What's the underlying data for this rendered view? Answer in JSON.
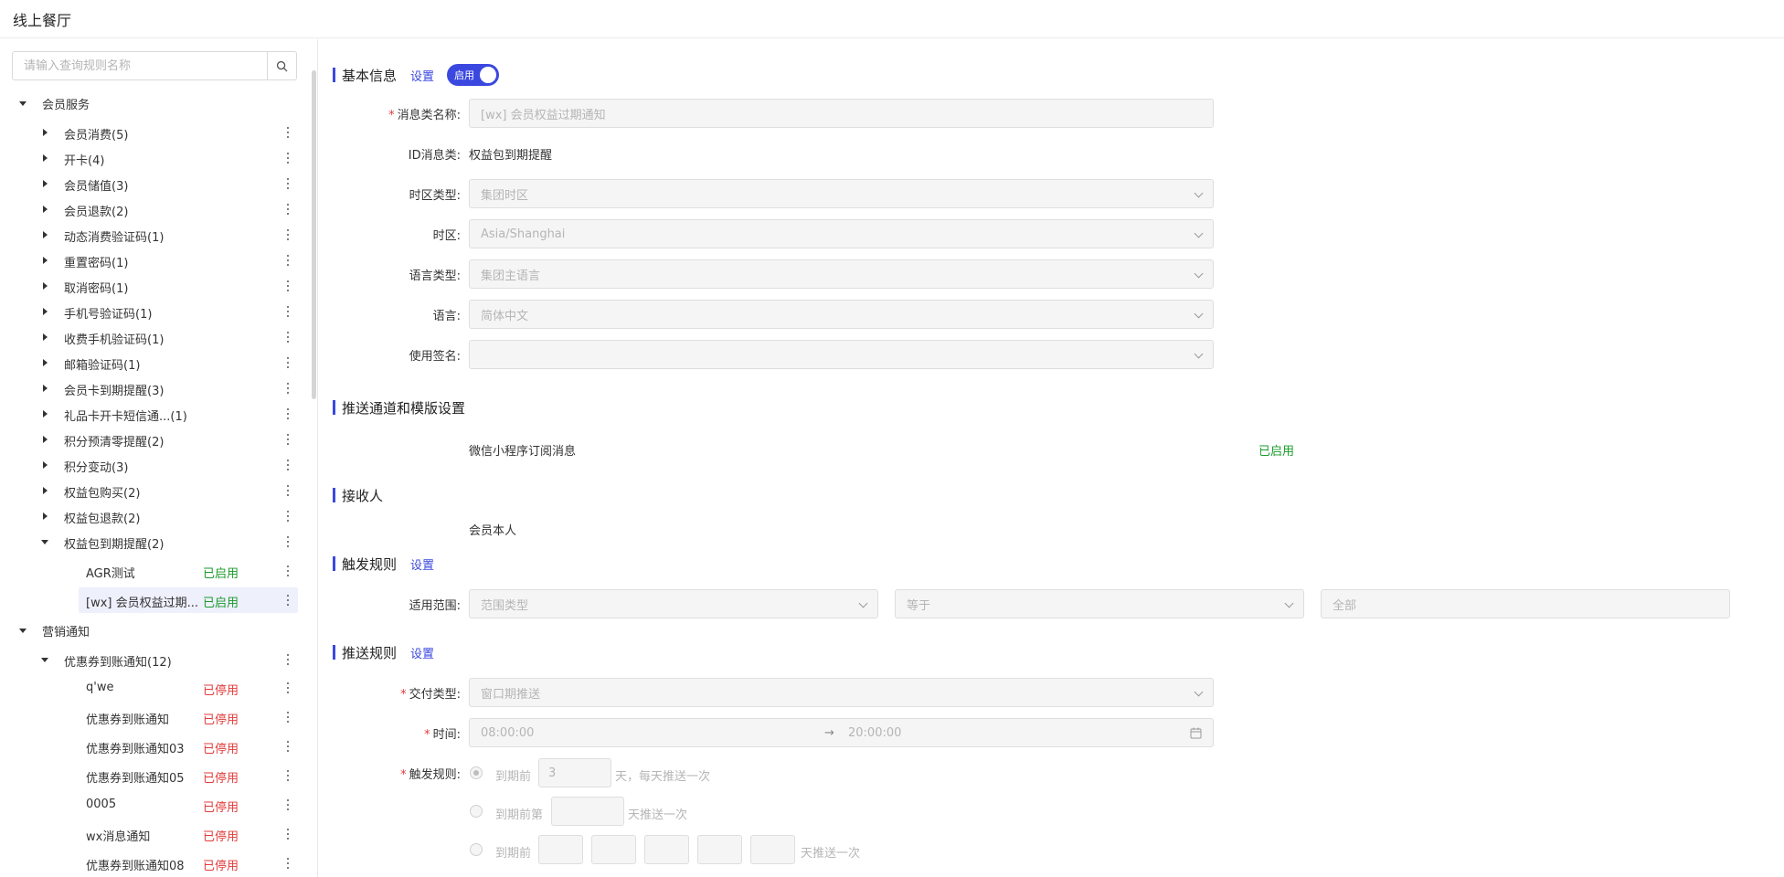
{
  "app": {
    "title": "线上餐厅"
  },
  "search": {
    "placeholder": "请输入查询规则名称"
  },
  "tree": {
    "groups": [
      {
        "label": "会员服务"
      },
      {
        "label": "营销通知"
      }
    ],
    "items": [
      {
        "label": "会员消费(5)"
      },
      {
        "label": "开卡(4)"
      },
      {
        "label": "会员储值(3)"
      },
      {
        "label": "会员退款(2)"
      },
      {
        "label": "动态消费验证码(1)"
      },
      {
        "label": "重置密码(1)"
      },
      {
        "label": "取消密码(1)"
      },
      {
        "label": "手机号验证码(1)"
      },
      {
        "label": "收费手机验证码(1)"
      },
      {
        "label": "邮箱验证码(1)"
      },
      {
        "label": "会员卡到期提醒(3)"
      },
      {
        "label": "礼品卡开卡短信通...(1)"
      },
      {
        "label": "积分预清零提醒(2)"
      },
      {
        "label": "积分变动(3)"
      },
      {
        "label": "权益包购买(2)"
      },
      {
        "label": "权益包退款(2)"
      },
      {
        "label": "权益包到期提醒(2)"
      },
      {
        "label": "优惠券到账通知(12)"
      }
    ],
    "leaves": [
      {
        "label": "AGR测试",
        "status": "已启用"
      },
      {
        "label": "[wx] 会员权益过期...",
        "status": "已启用"
      },
      {
        "label": "q'we",
        "status": "已停用"
      },
      {
        "label": "优惠券到账通知",
        "status": "已停用"
      },
      {
        "label": "优惠券到账通知03",
        "status": "已停用"
      },
      {
        "label": "优惠券到账通知05",
        "status": "已停用"
      },
      {
        "label": "0005",
        "status": "已停用"
      },
      {
        "label": "wx消息通知",
        "status": "已停用"
      },
      {
        "label": "优惠券到账通知08",
        "status": "已停用"
      }
    ]
  },
  "basic": {
    "title": "基本信息",
    "settings_link": "设置",
    "toggle_label": "启用",
    "fields": {
      "msg_name_label": "消息类名称:",
      "msg_name_value": "[wx] 会员权益过期通知",
      "id_label": "ID消息类:",
      "id_value": "权益包到期提醒",
      "tz_type_label": "时区类型:",
      "tz_type_value": "集团时区",
      "tz_label": "时区:",
      "tz_value": "Asia/Shanghai",
      "lang_type_label": "语言类型:",
      "lang_type_value": "集团主语言",
      "lang_label": "语言:",
      "lang_value": "简体中文",
      "sign_label": "使用签名:",
      "sign_value": ""
    }
  },
  "channel": {
    "title": "推送通道和模版设置",
    "name": "微信小程序订阅消息",
    "status": "已启用"
  },
  "receiver": {
    "title": "接收人",
    "value": "会员本人"
  },
  "trigger": {
    "title": "触发规则",
    "settings_link": "设置",
    "scope_label": "适用范围:",
    "scope_type": "范围类型",
    "operator": "等于",
    "value": "全部"
  },
  "push": {
    "title": "推送规则",
    "settings_link": "设置",
    "delivery_label": "交付类型:",
    "delivery_value": "窗口期推送",
    "time_label": "时间:",
    "time_start": "08:00:00",
    "time_arrow": "→",
    "time_end": "20:00:00",
    "rule_label": "触发规则:",
    "opt1_prefix": "到期前",
    "opt1_value": "3",
    "opt1_suffix": "天，每天推送一次",
    "opt2_prefix": "到期前第",
    "opt2_suffix": "天推送一次",
    "opt3_prefix": "到期前",
    "opt3_suffix": "天推送一次"
  },
  "colors": {
    "accent": "#3b48e0",
    "enabled": "#1a9a2c",
    "disabled": "#e23b3b"
  }
}
